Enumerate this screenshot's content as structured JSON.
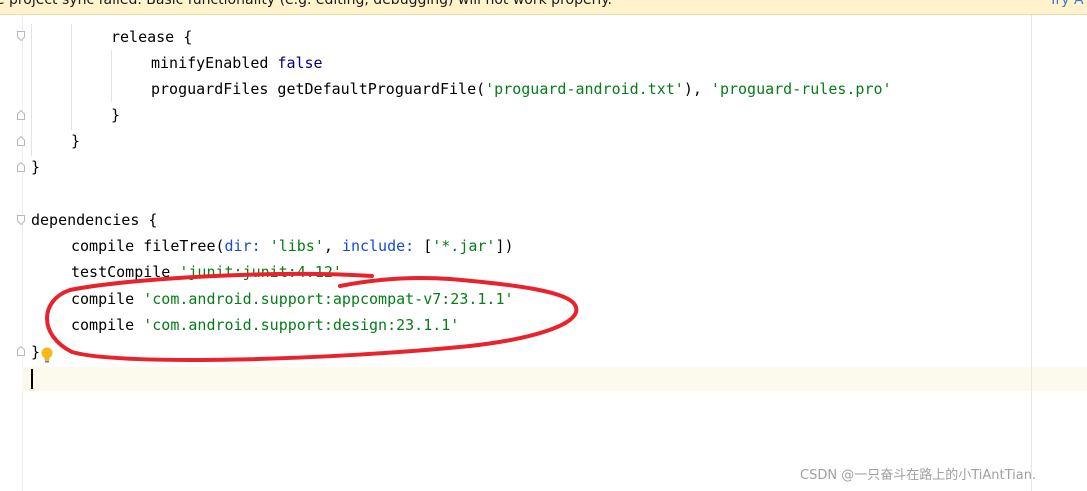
{
  "banner": {
    "message": "le project sync failed. Basic functionality (e.g. editing, debugging) will not work properly.",
    "action": "Try A"
  },
  "code": {
    "l1": {
      "name": "release",
      "brace": " {"
    },
    "l2": {
      "key": "minifyEnabled",
      "value": "false"
    },
    "l3": {
      "fn": "proguardFiles getDefaultProguardFile(",
      "s1": "'proguard-android.txt'",
      "sep": "), ",
      "s2": "'proguard-rules.pro'"
    },
    "l4": "}",
    "l5": "}",
    "l6": "}",
    "l7": {
      "name": "dependencies",
      "brace": " {"
    },
    "l8": {
      "cmd": "compile fileTree(",
      "arg1": "dir:",
      "v1": "'libs'",
      "sep1": ", ",
      "arg2": "include:",
      "pre2": " [",
      "v2": "'*.jar'",
      "post2": "])"
    },
    "l9": {
      "cmd": "testCompile ",
      "v": "'junit:junit:4.12'"
    },
    "l10": {
      "cmd": "compile ",
      "v": "'com.android.support:appcompat-v7:23.1.1'"
    },
    "l11": {
      "cmd": "compile ",
      "v": "'com.android.support:design:23.1.1'"
    },
    "l12": "}"
  },
  "watermark": "CSDN @一只奋斗在路上的小TiAntTian.",
  "colors": {
    "annotation": "#e8232e",
    "string": "#067d17",
    "keyword": "#000080",
    "named_arg": "#174ad4"
  },
  "icons": [
    "fold-marker-icon",
    "lightbulb-icon"
  ]
}
